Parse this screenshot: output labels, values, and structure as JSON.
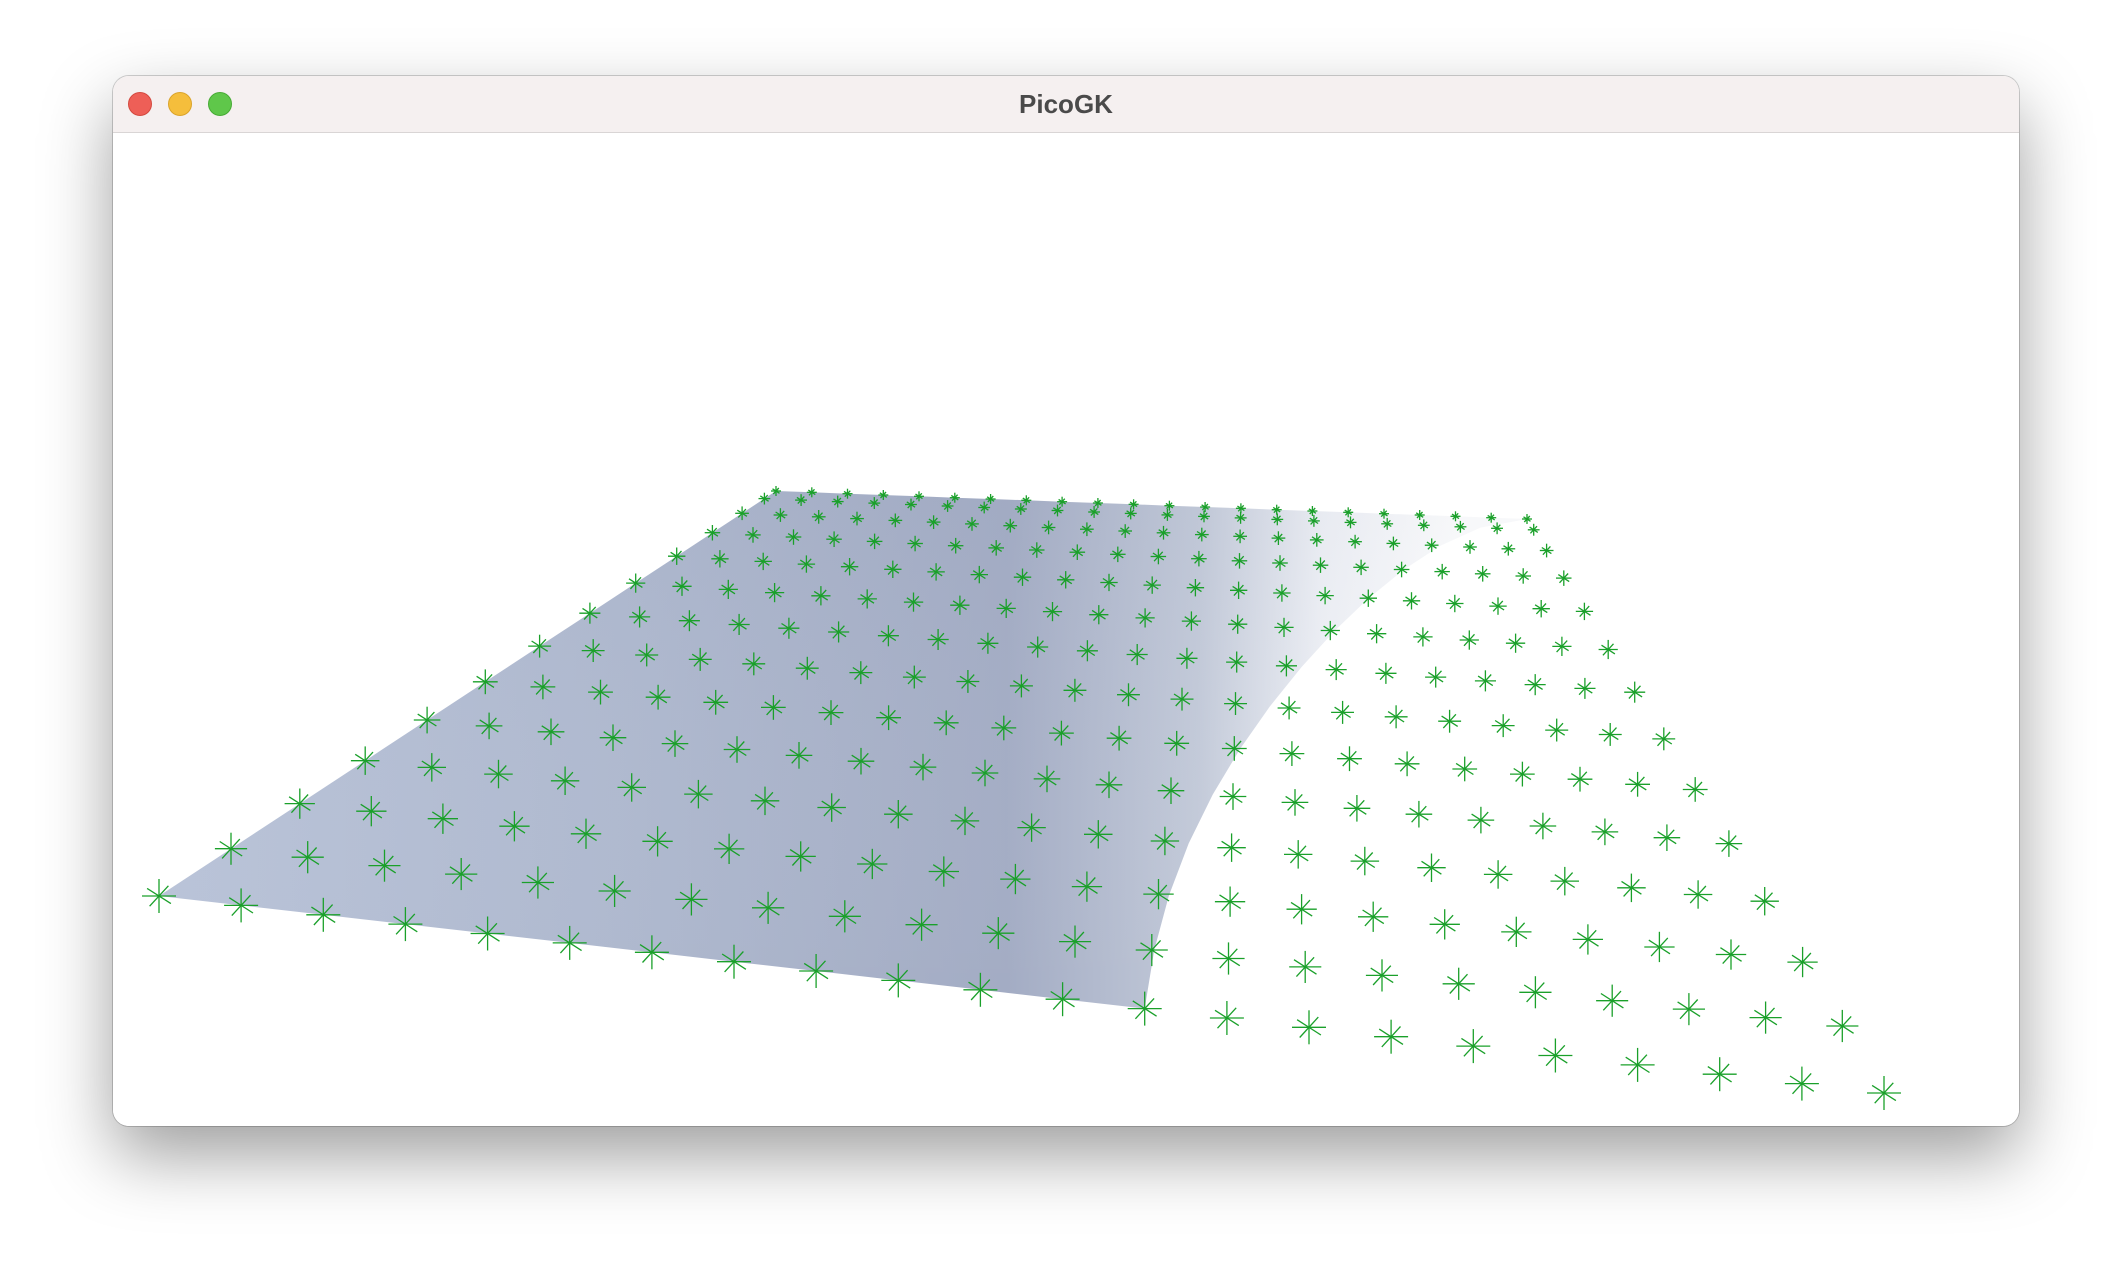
{
  "window": {
    "title": "PicoGK",
    "controls": {
      "close": "close-button",
      "minimize": "minimize-button",
      "zoom": "zoom-button"
    }
  },
  "viewport": {
    "background": "#ffffff",
    "surface_color": "#aab4cb",
    "marker_color": "#1aa02a",
    "marker_icon": "asterisk-marker"
  }
}
